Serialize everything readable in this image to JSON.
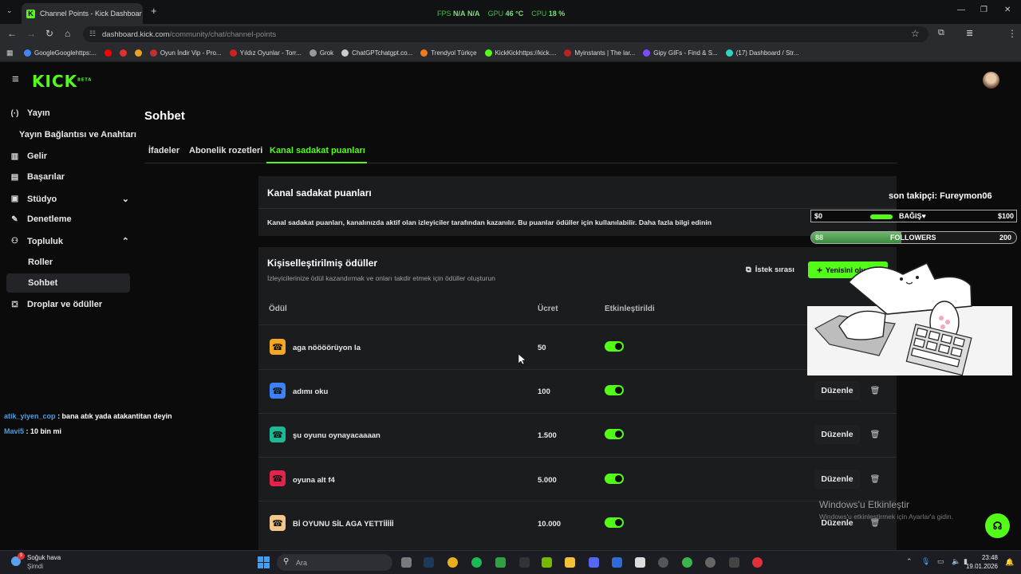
{
  "browser": {
    "tab_title": "Channel Points - Kick Dashboar",
    "url_host": "dashboard.kick.com",
    "url_path": "/community/chat/channel-points",
    "perf": {
      "fps_label": "FPS",
      "fps_value": "N/A",
      "fps_value2": "N/A",
      "gpu_label": "GPU",
      "gpu_value": "46 °C",
      "cpu_label": "CPU",
      "cpu_value": "18 %"
    },
    "bookmarks": [
      {
        "label": "GoogleGooglehttps:...",
        "color": "#4285f4"
      },
      {
        "label": "",
        "color": "#ff0000"
      },
      {
        "label": "",
        "color": "#e03030"
      },
      {
        "label": "",
        "color": "#f0a020"
      },
      {
        "label": "Oyun İndir Vip - Pro...",
        "color": "#c03030"
      },
      {
        "label": "Yıldız Oyunlar - Torr...",
        "color": "#cc2222"
      },
      {
        "label": "Grok",
        "color": "#999999"
      },
      {
        "label": "ChatGPTchatgpt.co...",
        "color": "#cccccc"
      },
      {
        "label": "Trendyol Türkçe",
        "color": "#f27a1a"
      },
      {
        "label": "KickKickhttps://kick....",
        "color": "#53fc18"
      },
      {
        "label": "Myinstants | The lar...",
        "color": "#c02020"
      },
      {
        "label": "Gipy GIFs - Find & S...",
        "color": "#7b4cff"
      },
      {
        "label": "(17) Dashboard / Str...",
        "color": "#2dd4bf"
      }
    ]
  },
  "app": {
    "logo": "KICK",
    "logo_badge": "BETA"
  },
  "sidebar": {
    "items": [
      {
        "label": "Yayın",
        "icon": "broadcast-icon"
      },
      {
        "label": "Yayın Bağlantısı ve Anahtarı",
        "icon": ""
      },
      {
        "label": "Gelir",
        "icon": "revenue-icon"
      },
      {
        "label": "Başarılar",
        "icon": "achievements-icon"
      },
      {
        "label": "Stüdyo",
        "icon": "studio-icon"
      },
      {
        "label": "Denetleme",
        "icon": "moderation-icon"
      },
      {
        "label": "Topluluk",
        "icon": "community-icon"
      },
      {
        "label": "Roller",
        "icon": ""
      },
      {
        "label": "Sohbet",
        "icon": ""
      },
      {
        "label": "Droplar ve ödüller",
        "icon": "drops-icon"
      }
    ]
  },
  "main": {
    "title": "Sohbet",
    "tabs": [
      "İfadeler",
      "Abonelik rozetleri",
      "Kanal sadakat puanları"
    ],
    "info_card": {
      "title": "Kanal sadakat puanları",
      "body": "Kanal sadakat puanları, kanalınızda aktif olan izleyiciler tarafından kazanılır. Bu puanlar ödüller için kullanılabilir. Daha fazla bilgi edinin"
    },
    "rewards_card": {
      "title": "Kişiselleştirilmiş ödüller",
      "subtitle": "İzleyicilerinize ödül kazandırmak ve onları takdir etmek için ödüller oluşturun",
      "queue_label": "İstek sırası",
      "create_label": "Yenisini oluştur",
      "columns": [
        "Ödül",
        "Ücret",
        "Etkinleştirildi"
      ],
      "edit_label": "Düzenle",
      "rows": [
        {
          "name": "aga nöööörüyon la",
          "cost": "50",
          "color": "#f5a623",
          "enabled": true
        },
        {
          "name": "adımı oku",
          "cost": "100",
          "color": "#3b82f6",
          "enabled": true
        },
        {
          "name": "şu oyunu oynayacaaaan",
          "cost": "1.500",
          "color": "#1fb894",
          "enabled": true
        },
        {
          "name": "oyuna alt f4",
          "cost": "5.000",
          "color": "#e0254a",
          "enabled": true
        },
        {
          "name": "Bİ OYUNU SİL AGA YETTİİİİİ",
          "cost": "10.000",
          "color": "#f3c78a",
          "enabled": true
        }
      ]
    }
  },
  "overlay": {
    "last_follower": "son takipçi: Fureymon06",
    "donation": {
      "left": "$0",
      "label": "BAĞIŞ♥",
      "right": "$100"
    },
    "followers": {
      "left": "88",
      "label": "FOLLOWERS",
      "right": "200",
      "progress": 0.44
    },
    "chat": [
      {
        "user": "atik_yiyen_cop",
        "text": ": bana atık yada atakantitan deyin"
      },
      {
        "user": "Mavi5",
        "text": ": 10 bin mi"
      }
    ],
    "watermark_title": "Windows'u Etkinleştir",
    "watermark_sub": "Windows'u etkinleştirmek için Ayarlar'a gidin."
  },
  "taskbar": {
    "weather_title": "Soğuk hava",
    "weather_sub": "Şimdi",
    "weather_badge": "9",
    "search_placeholder": "Ara",
    "time": "23:48",
    "date": "19.01.2026"
  }
}
